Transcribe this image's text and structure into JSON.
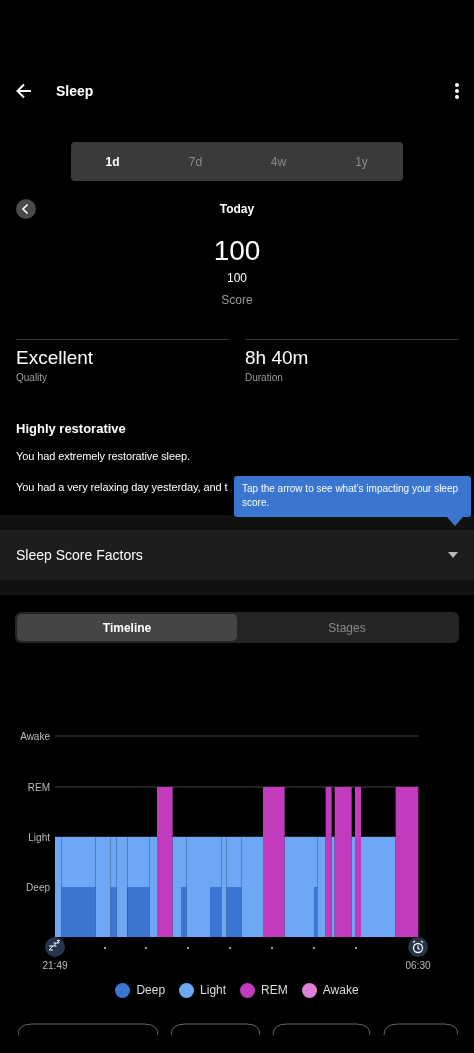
{
  "header": {
    "title": "Sleep"
  },
  "periods": [
    {
      "label": "1d",
      "selected": true
    },
    {
      "label": "7d",
      "selected": false
    },
    {
      "label": "4w",
      "selected": false
    },
    {
      "label": "1y",
      "selected": false
    }
  ],
  "date": "Today",
  "score": {
    "value": "100",
    "secondary": "100",
    "label": "Score"
  },
  "stats": [
    {
      "value": "Excellent",
      "label": "Quality"
    },
    {
      "value": "8h 40m",
      "label": "Duration"
    }
  ],
  "summary": {
    "title": "Highly restorative",
    "paragraphs": [
      "You had extremely restorative sleep.",
      "You had a very relaxing day yesterday, and t"
    ]
  },
  "tooltip": "Tap the arrow to see what’s impacting your sleep score.",
  "factors": {
    "label": "Sleep Score Factors",
    "expanded": false
  },
  "view_tabs": [
    {
      "label": "Timeline",
      "selected": true
    },
    {
      "label": "Stages",
      "selected": false
    }
  ],
  "hypnogram": {
    "stage_labels": [
      "Awake",
      "REM",
      "Light",
      "Deep"
    ],
    "start": "21:49",
    "end": "06:30"
  },
  "legend": [
    {
      "label": "Deep",
      "color": "#3b76d2"
    },
    {
      "label": "Light",
      "color": "#6ea7f6"
    },
    {
      "label": "REM",
      "color": "#c23bbd"
    },
    {
      "label": "Awake",
      "color": "#de7fd8"
    }
  ]
}
